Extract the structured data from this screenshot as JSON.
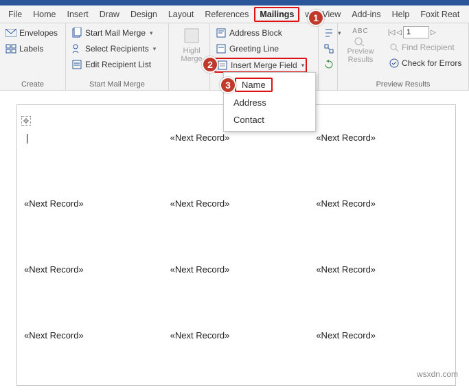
{
  "tabs": {
    "file": "File",
    "home": "Home",
    "insert": "Insert",
    "draw": "Draw",
    "design": "Design",
    "layout": "Layout",
    "references": "References",
    "mailings": "Mailings",
    "w": "w",
    "view": "View",
    "addins": "Add-ins",
    "help": "Help",
    "foxit": "Foxit Reat"
  },
  "create": {
    "envelopes": "Envelopes",
    "labels": "Labels",
    "group": "Create"
  },
  "startmm": {
    "start": "Start Mail Merge",
    "select": "Select Recipients",
    "edit": "Edit Recipient List",
    "group": "Start Mail Merge"
  },
  "highlight": {
    "line1": "Highl",
    "line2": "Merge"
  },
  "write": {
    "address": "Address Block",
    "greeting": "Greeting Line",
    "insert": "Insert Merge Field"
  },
  "rules": "",
  "preview": {
    "abc": "ABC",
    "title": "Preview",
    "title2": "Results",
    "find": "Find Recipient",
    "check": "Check for Errors",
    "group": "Preview Results",
    "record": "1"
  },
  "menu": {
    "name": "Name",
    "address": "Address",
    "contact": "Contact"
  },
  "rec": "«Next Record»",
  "watermark": "wsxdn.com"
}
